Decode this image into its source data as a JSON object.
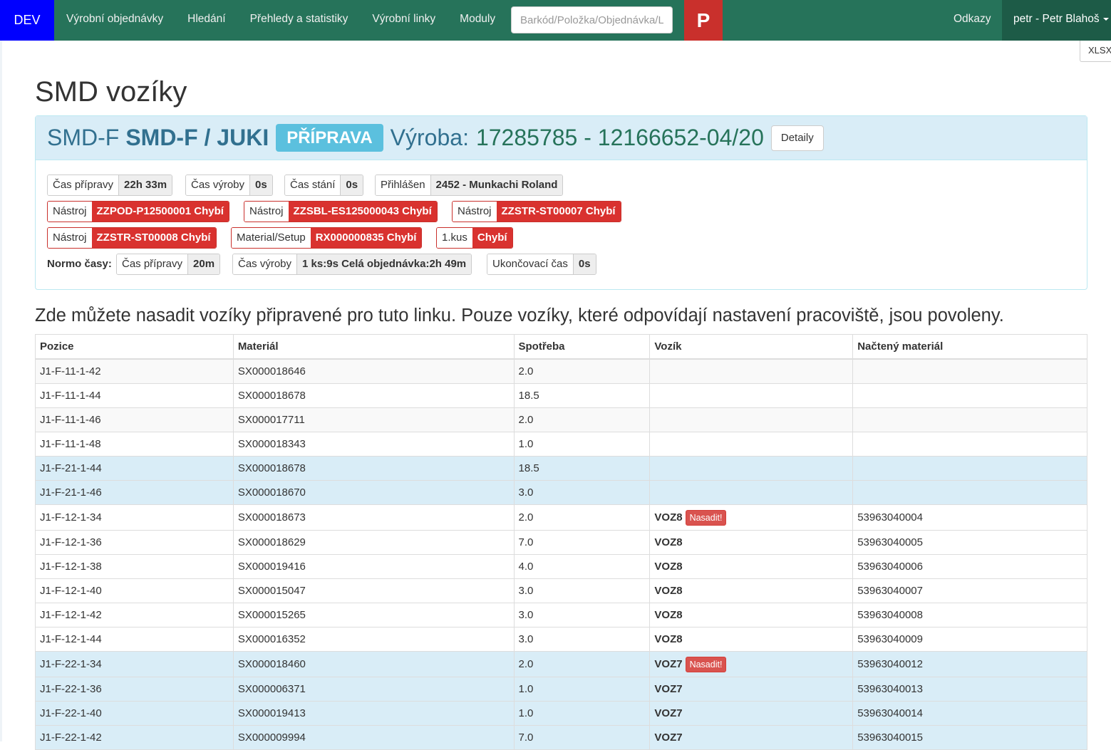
{
  "nav": {
    "env": "DEV",
    "items": [
      "Výrobní objednávky",
      "Hledání",
      "Přehledy a statistiky",
      "Výrobní linky",
      "Moduly"
    ],
    "search_placeholder": "Barkód/Položka/Objednávka/Linka",
    "p_button": "P",
    "links_label": "Odkazy",
    "user_label": "petr - Petr Blahoš"
  },
  "xlsx_label": "XLSX",
  "page_title": "SMD vozíky",
  "panel": {
    "line_code": "SMD-F",
    "line_name": "SMD-F / JUKI",
    "state_label": "PŘÍPRAVA",
    "vyroba_label": "Výroba:",
    "vyroba_value": "17285785 - 12166652-04/20",
    "details_button": "Detaily",
    "row1": [
      {
        "k": "Čas přípravy",
        "v": "22h 33m"
      },
      {
        "k": "Čas výroby",
        "v": "0s"
      },
      {
        "k": "Čas stání",
        "v": "0s"
      },
      {
        "k": "Přihlášen",
        "v": "2452 - Munkachi Roland"
      }
    ],
    "row2": [
      {
        "k": "Nástroj",
        "v": "ZZPOD-P12500001 Chybí"
      },
      {
        "k": "Nástroj",
        "v": "ZZSBL-ES125000043 Chybí"
      },
      {
        "k": "Nástroj",
        "v": "ZZSTR-ST00007 Chybí"
      }
    ],
    "row3": [
      {
        "k": "Nástroj",
        "v": "ZZSTR-ST00008 Chybí"
      },
      {
        "k": "Material/Setup",
        "v": "RX000000835 Chybí"
      },
      {
        "k": "1.kus",
        "v": "Chybí"
      }
    ],
    "normo_label": "Normo časy:",
    "row4": [
      {
        "k": "Čas přípravy",
        "v": "20m"
      },
      {
        "k": "Čas výroby",
        "v": "1 ks:9s Celá objednávka:2h 49m"
      },
      {
        "k": "Ukončovací čas",
        "v": "0s"
      }
    ]
  },
  "intro_text": "Zde můžete nasadit vozíky připravené pro tuto linku. Pouze vozíky, které odpovídají nastavení pracoviště, jsou povoleny.",
  "table": {
    "headers": [
      "Pozice",
      "Materiál",
      "Spotřeba",
      "Vozík",
      "Načtený materiál"
    ],
    "nasadit_label": "Nasadit!",
    "rows": [
      {
        "pozice": "J1-F-11-1-42",
        "material": "SX000018646",
        "spotreba": "2.0",
        "vozik": "",
        "nacteny": ""
      },
      {
        "pozice": "J1-F-11-1-44",
        "material": "SX000018678",
        "spotreba": "18.5",
        "vozik": "",
        "nacteny": ""
      },
      {
        "pozice": "J1-F-11-1-46",
        "material": "SX000017711",
        "spotreba": "2.0",
        "vozik": "",
        "nacteny": ""
      },
      {
        "pozice": "J1-F-11-1-48",
        "material": "SX000018343",
        "spotreba": "1.0",
        "vozik": "",
        "nacteny": ""
      },
      {
        "pozice": "J1-F-21-1-44",
        "material": "SX000018678",
        "spotreba": "18.5",
        "vozik": "",
        "nacteny": ""
      },
      {
        "pozice": "J1-F-21-1-46",
        "material": "SX000018670",
        "spotreba": "3.0",
        "vozik": "",
        "nacteny": ""
      },
      {
        "pozice": "J1-F-12-1-34",
        "material": "SX000018673",
        "spotreba": "2.0",
        "vozik": "VOZ8",
        "nacteny": "53963040004"
      },
      {
        "pozice": "J1-F-12-1-36",
        "material": "SX000018629",
        "spotreba": "7.0",
        "vozik": "VOZ8",
        "nacteny": "53963040005"
      },
      {
        "pozice": "J1-F-12-1-38",
        "material": "SX000019416",
        "spotreba": "4.0",
        "vozik": "VOZ8",
        "nacteny": "53963040006"
      },
      {
        "pozice": "J1-F-12-1-40",
        "material": "SX000015047",
        "spotreba": "3.0",
        "vozik": "VOZ8",
        "nacteny": "53963040007"
      },
      {
        "pozice": "J1-F-12-1-42",
        "material": "SX000015265",
        "spotreba": "3.0",
        "vozik": "VOZ8",
        "nacteny": "53963040008"
      },
      {
        "pozice": "J1-F-12-1-44",
        "material": "SX000016352",
        "spotreba": "3.0",
        "vozik": "VOZ8",
        "nacteny": "53963040009"
      },
      {
        "pozice": "J1-F-22-1-34",
        "material": "SX000018460",
        "spotreba": "2.0",
        "vozik": "VOZ7",
        "nacteny": "53963040012"
      },
      {
        "pozice": "J1-F-22-1-36",
        "material": "SX000006371",
        "spotreba": "1.0",
        "vozik": "VOZ7",
        "nacteny": "53963040013"
      },
      {
        "pozice": "J1-F-22-1-40",
        "material": "SX000019413",
        "spotreba": "1.0",
        "vozik": "VOZ7",
        "nacteny": "53963040014"
      },
      {
        "pozice": "J1-F-22-1-42",
        "material": "SX000009994",
        "spotreba": "7.0",
        "vozik": "VOZ7",
        "nacteny": "53963040015"
      }
    ]
  },
  "colors": {
    "navbar": "#26735a",
    "dev_badge": "#0000ff",
    "p_button": "#c9302c",
    "state_badge": "#5bc0de",
    "danger": "#d9322f",
    "info_row": "#d9edf7"
  }
}
